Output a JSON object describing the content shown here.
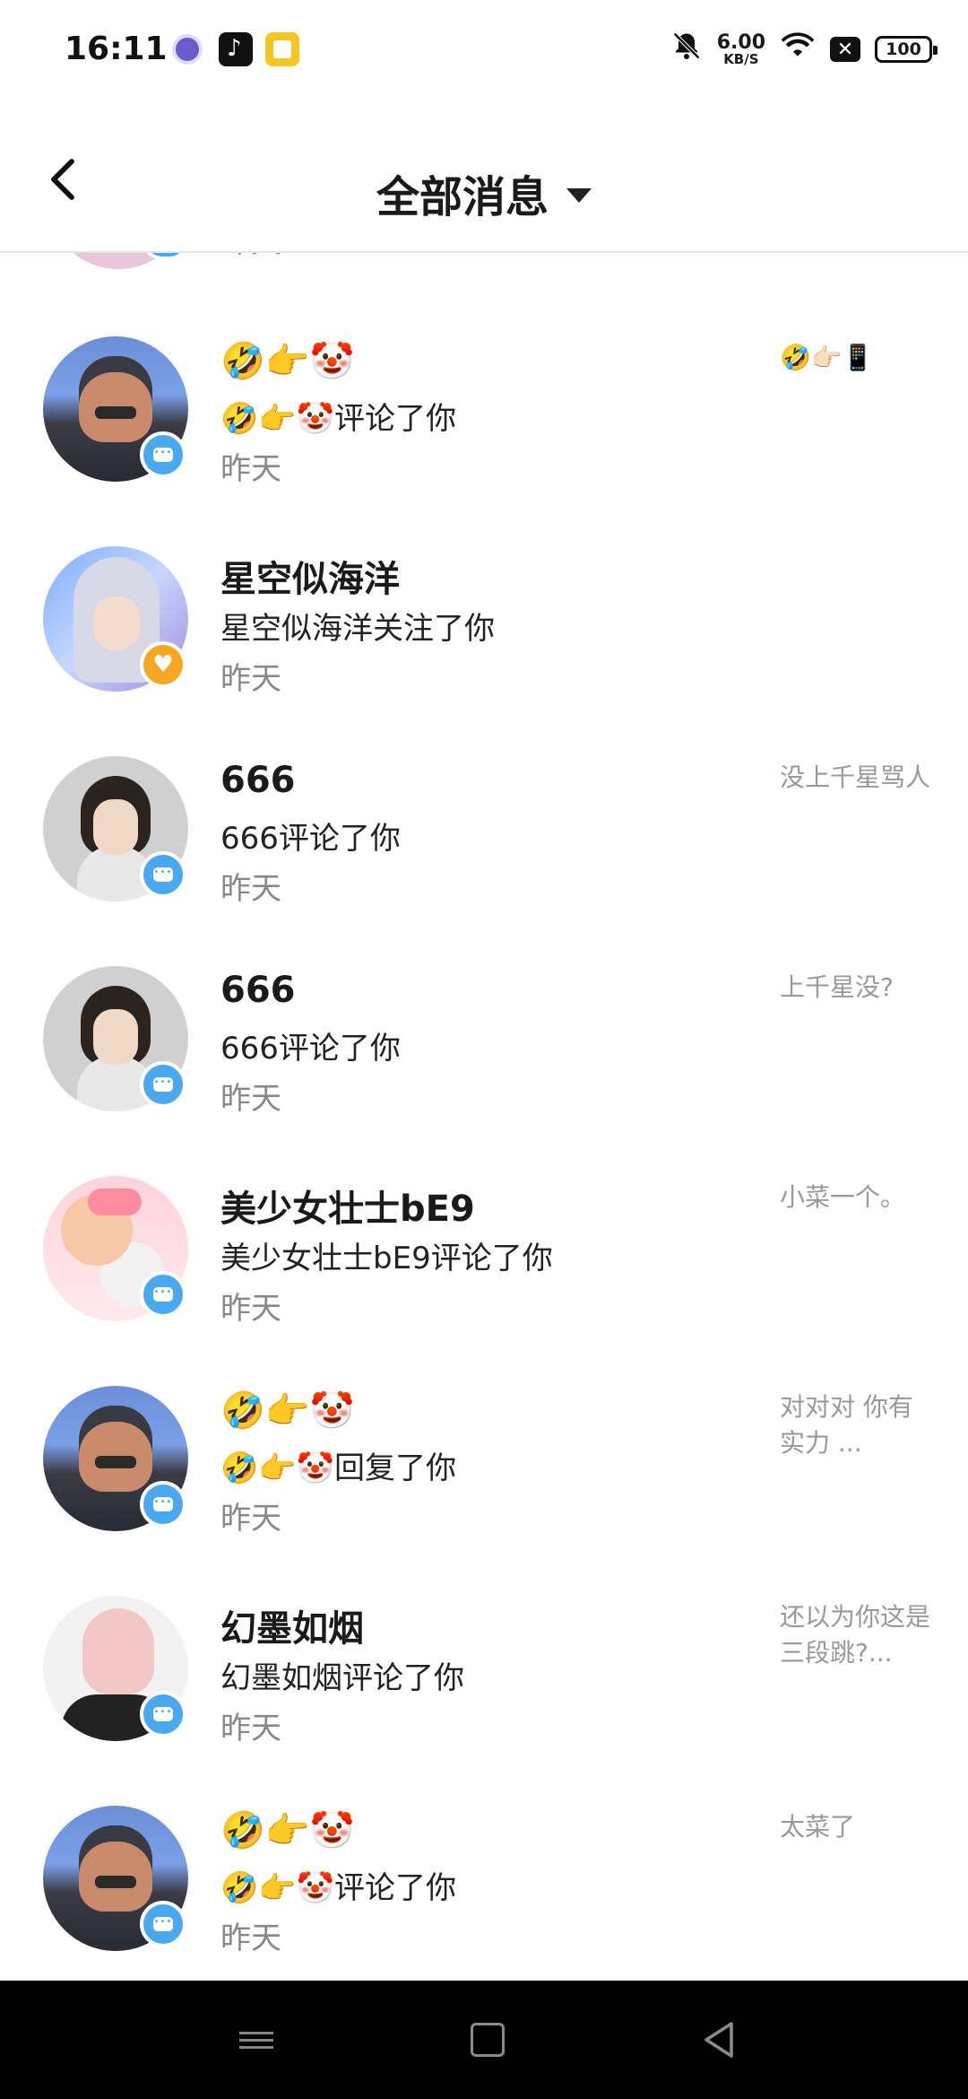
{
  "status_bar": {
    "time": "16:11",
    "speed_value": "6.00",
    "speed_unit": "KB/S",
    "battery": "100",
    "icons": [
      "mute-bell-icon",
      "wifi-icon",
      "no-sim-icon",
      "battery-icon"
    ]
  },
  "header": {
    "title": "全部消息"
  },
  "partial_item": {
    "time": "昨天"
  },
  "messages": [
    {
      "name": "🤣👉🤡",
      "action": "🤣👉🤡评论了你",
      "time": "昨天",
      "preview": "🤣👉🏻📱",
      "badge": "comment",
      "avatar": "robot"
    },
    {
      "name": "星空似海洋",
      "action": "星空似海洋关注了你",
      "time": "昨天",
      "preview": "",
      "badge": "follow",
      "avatar": "girl"
    },
    {
      "name": "666",
      "action": "666评论了你",
      "time": "昨天",
      "preview": "没上千星骂人",
      "badge": "comment",
      "avatar": "man"
    },
    {
      "name": "666",
      "action": "666评论了你",
      "time": "昨天",
      "preview": "上千星没?",
      "badge": "comment",
      "avatar": "man"
    },
    {
      "name": "美少女壮士bE9",
      "action": "美少女壮士bE9评论了你",
      "time": "昨天",
      "preview": "小菜一个。",
      "badge": "comment",
      "avatar": "anime"
    },
    {
      "name": "🤣👉🤡",
      "action": "🤣👉🤡回复了你",
      "time": "昨天",
      "preview": "对对对 你有实力 ...",
      "badge": "comment",
      "avatar": "robot"
    },
    {
      "name": "幻墨如烟",
      "action": "幻墨如烟评论了你",
      "time": "昨天",
      "preview": "还以为你这是三段跳?...",
      "badge": "comment",
      "avatar": "pink"
    },
    {
      "name": "🤣👉🤡",
      "action": "🤣👉🤡评论了你",
      "time": "昨天",
      "preview": "太菜了",
      "badge": "comment",
      "avatar": "robot"
    }
  ]
}
